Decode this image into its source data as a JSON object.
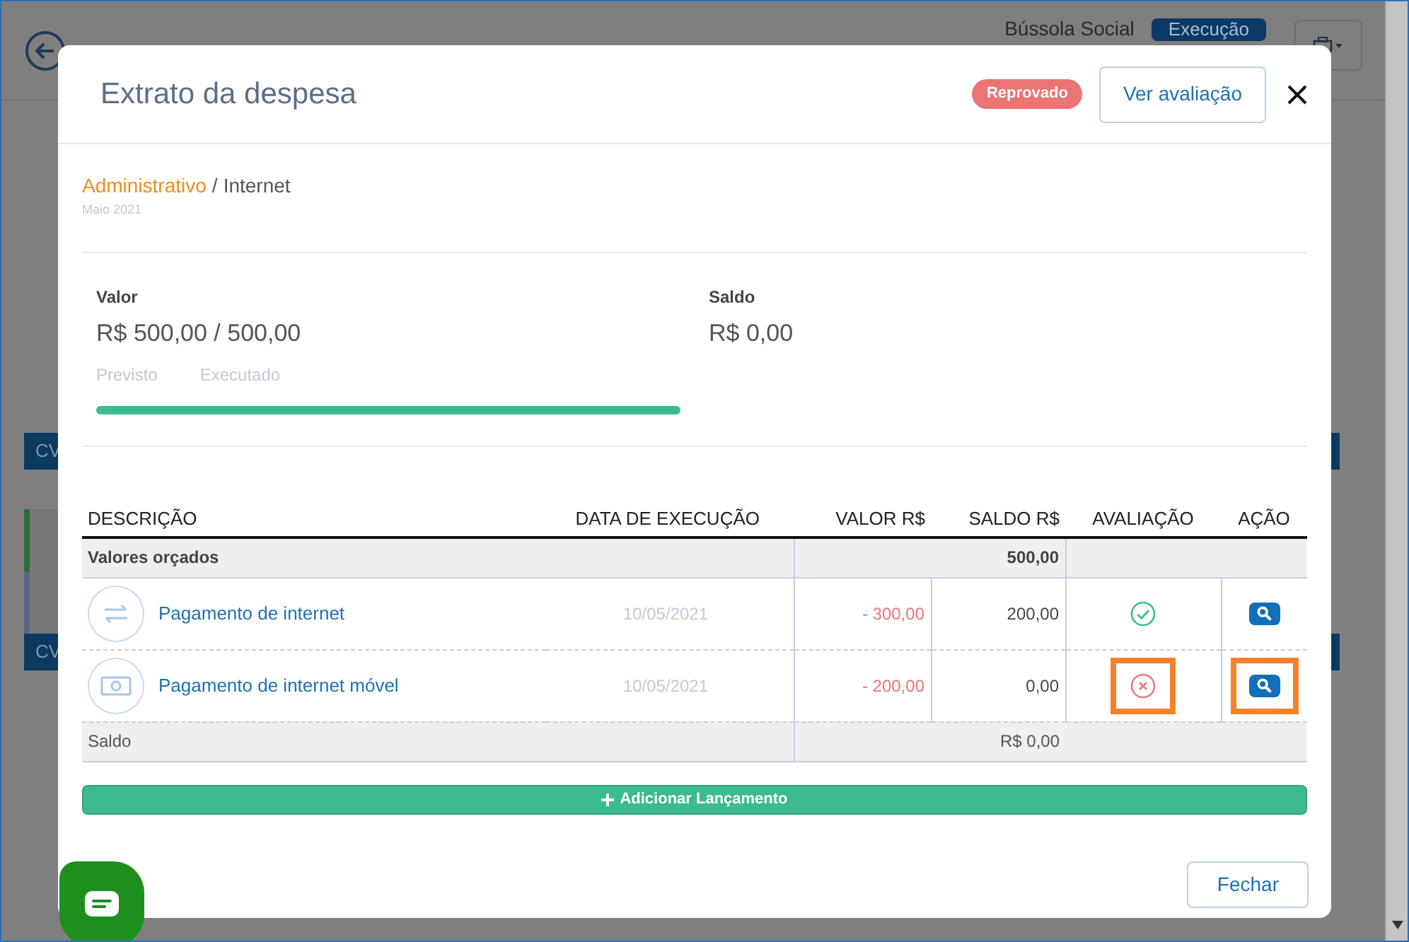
{
  "background": {
    "org": "Bússola Social",
    "status_badge": "Execução",
    "side_labels": [
      "CV",
      "CV"
    ]
  },
  "modal": {
    "title": "Extrato da despesa",
    "status_badge": "Reprovado",
    "evaluation_button": "Ver avaliação",
    "category": "Administrativo",
    "separator": "/",
    "subcategory": "Internet",
    "period": "Maio 2021",
    "valor": {
      "label": "Valor",
      "amount": "R$ 500,00 / 500,00",
      "legend": [
        "Previsto",
        "Executado"
      ],
      "level": 1
    },
    "saldo": {
      "label": "Saldo",
      "amount": "R$ 0,00"
    },
    "table": {
      "columns": [
        "DESCRIÇÃO",
        "DATA DE EXECUÇÃO",
        "VALOR R$",
        "SALDO R$",
        "AVALIAÇÃO",
        "AÇÃO"
      ],
      "budget_row": {
        "label": "Valores orçados",
        "value": "500,00"
      },
      "rows": [
        {
          "kind": "transfer",
          "description": "Pagamento de internet",
          "date": "10/05/2021",
          "value": "- 300,00",
          "balance": "200,00",
          "approved": true,
          "highlighted": false
        },
        {
          "kind": "cash",
          "description": "Pagamento de internet móvel",
          "date": "10/05/2021",
          "value": "- 200,00",
          "balance": "0,00",
          "approved": false,
          "highlighted": true
        }
      ],
      "total_row": {
        "label": "Saldo",
        "value": "R$ 0,00"
      }
    },
    "add_button": "Adicionar Lançamento",
    "close_button": "Fechar"
  }
}
